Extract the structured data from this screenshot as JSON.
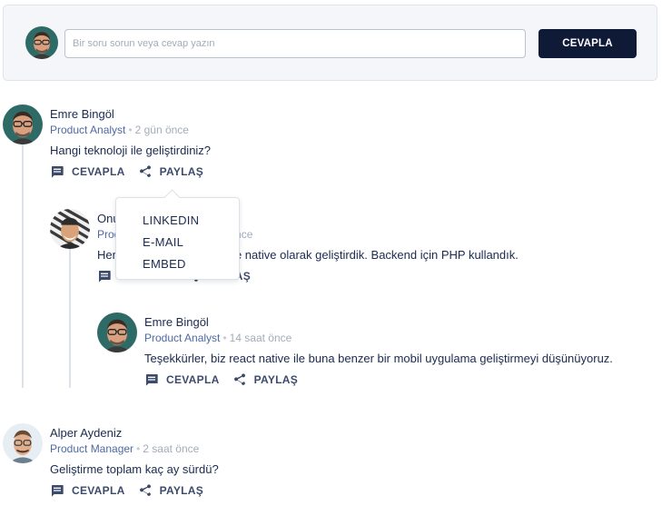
{
  "composer": {
    "placeholder": "Bir soru sorun veya cevap yazın",
    "submit_label": "CEVAPLA"
  },
  "comments": [
    {
      "name": "Emre Bingöl",
      "role": "Product Analyst",
      "time": "2 gün önce",
      "text": "Hangi teknoloji ile geliştirdiniz?",
      "reply_label": "CEVAPLA",
      "share_label": "PAYLAŞ"
    },
    {
      "name": "Onur",
      "role": "Product",
      "time": "once",
      "text": "Her",
      "text_tail": "e native olarak geliştirdik. Backend için PHP kullandık.",
      "reply_label": "CEVAPLA",
      "share_label": "PAYLAŞ"
    },
    {
      "name": "Emre Bingöl",
      "role": "Product Analyst",
      "time": "14 saat önce",
      "text": "Teşekkürler, biz react native ile buna benzer bir mobil uygulama geliştirmeyi düşünüyoruz.",
      "reply_label": "CEVAPLA",
      "share_label": "PAYLAŞ"
    },
    {
      "name": "Alper Aydeniz",
      "role": "Product Manager",
      "time": "2 saat önce",
      "text": "Geliştirme toplam kaç ay sürdü?",
      "reply_label": "CEVAPLA",
      "share_label": "PAYLAŞ"
    }
  ],
  "share_menu": {
    "items": [
      "LINKEDIN",
      "E-MAIL",
      "EMBED"
    ]
  },
  "icons": {
    "reply": "comment-icon",
    "share": "share-icon"
  },
  "colors": {
    "primary_button": "#0f1a36",
    "role_text": "#4e6aa3",
    "muted_text": "#a3acba",
    "thread_line": "#dde1e8"
  }
}
